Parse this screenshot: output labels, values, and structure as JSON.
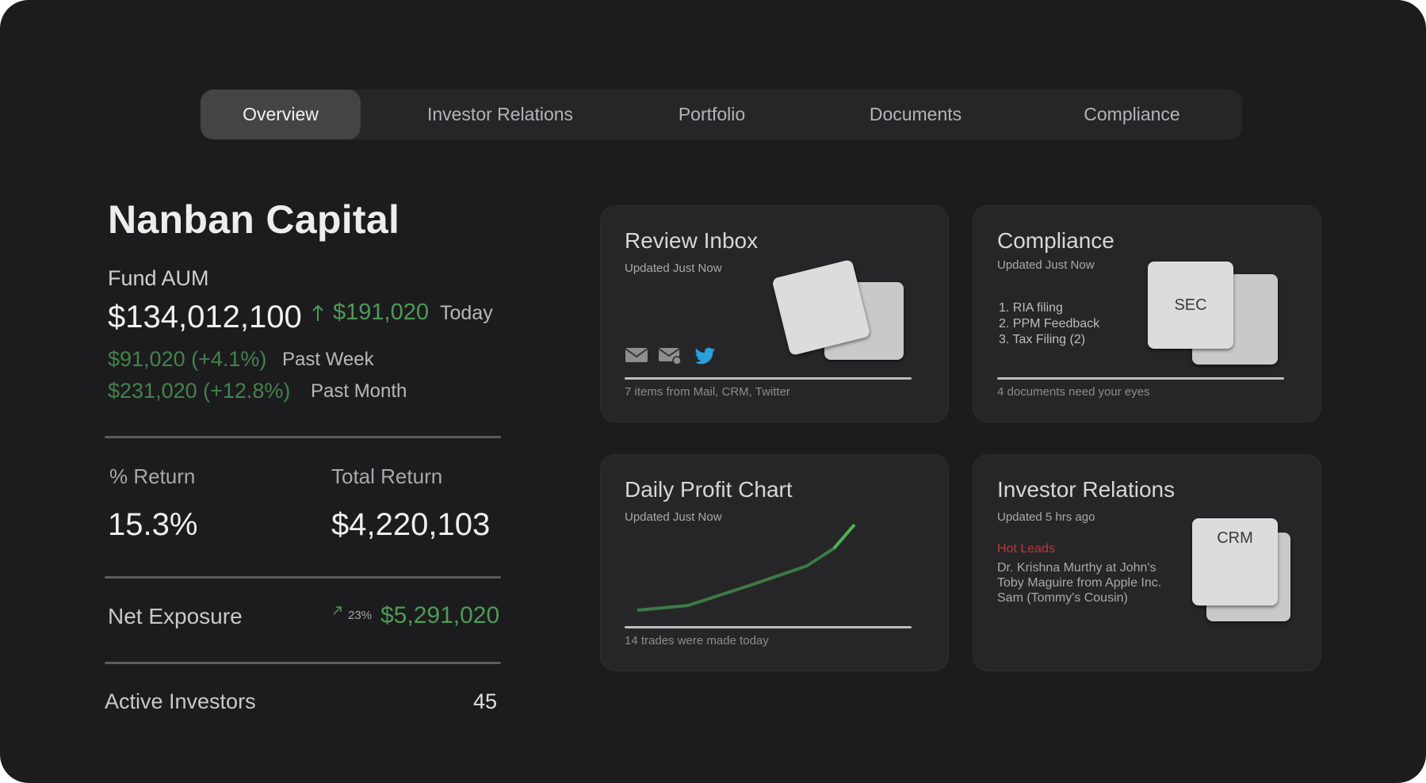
{
  "tabs": [
    {
      "label": "Overview",
      "active": true
    },
    {
      "label": "Investor Relations"
    },
    {
      "label": "Portfolio"
    },
    {
      "label": "Documents"
    },
    {
      "label": "Compliance"
    }
  ],
  "fund": {
    "name": "Nanban Capital",
    "aum_label": "Fund AUM",
    "aum_value": "$134,012,100",
    "today_change": "$191,020",
    "today_label": "Today",
    "week_change": "$91,020 (+4.1%)",
    "week_label": "Past Week",
    "month_change": "$231,020 (+12.8%)",
    "month_label": "Past Month"
  },
  "stats": {
    "pct_return_label": "% Return",
    "pct_return_value": "15.3%",
    "total_return_label": "Total Return",
    "total_return_value": "$4,220,103",
    "net_exposure_label": "Net Exposure",
    "net_exposure_pct": "23%",
    "net_exposure_value": "$5,291,020",
    "active_investors_label": "Active Investors",
    "active_investors_value": "45"
  },
  "cards": {
    "review_inbox": {
      "title": "Review Inbox",
      "subtitle": "Updated Just Now",
      "footer": "7 items from Mail, CRM, Twitter",
      "icons": [
        "mail-icon",
        "mail-settings-icon",
        "twitter-icon"
      ]
    },
    "compliance": {
      "title": "Compliance",
      "subtitle": "Updated Just Now",
      "items": [
        "1. RIA filing",
        "2. PPM Feedback",
        "3. Tax Filing (2)"
      ],
      "doc_label": "SEC",
      "footer": "4 documents need your eyes"
    },
    "daily_profit": {
      "title": "Daily Profit Chart",
      "subtitle": "Updated Just Now",
      "footer": "14 trades were made today"
    },
    "investor_relations": {
      "title": "Investor Relations",
      "subtitle": "Updated 5 hrs ago",
      "hot_leads_label": "Hot Leads",
      "leads": [
        "Dr. Krishna Murthy at John's",
        "Toby Maguire from Apple Inc.",
        "Sam (Tommy's Cousin)"
      ],
      "doc_label": "CRM"
    }
  },
  "colors": {
    "accent_green": "#4e9a57",
    "hot_red": "#b63a3a",
    "twitter_blue": "#2aa0dc"
  }
}
